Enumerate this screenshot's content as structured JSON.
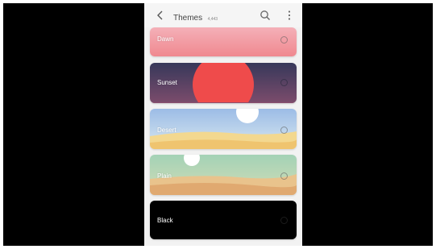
{
  "header": {
    "back_icon": "back-arrow-icon",
    "title": "Themes",
    "count": "4,443",
    "search_icon": "search-icon",
    "more_icon": "more-vert-icon"
  },
  "themes": [
    {
      "label": "Dawn",
      "selected": false
    },
    {
      "label": "Sunset",
      "selected": false
    },
    {
      "label": "Desert",
      "selected": false
    },
    {
      "label": "Plain",
      "selected": false
    },
    {
      "label": "Black",
      "selected": false
    }
  ],
  "colors": {
    "dawn": [
      "#f4a6b0",
      "#f08a8e"
    ],
    "sunset": [
      "#3a3a5e",
      "#7a4a6a"
    ],
    "sun": "#ef4b4b",
    "desert_sky": "#a8c6ea",
    "desert_sand": "#f2cf82",
    "plain_top": "#9fd0b4",
    "plain_bottom": "#e4b07c",
    "black": "#000000"
  }
}
